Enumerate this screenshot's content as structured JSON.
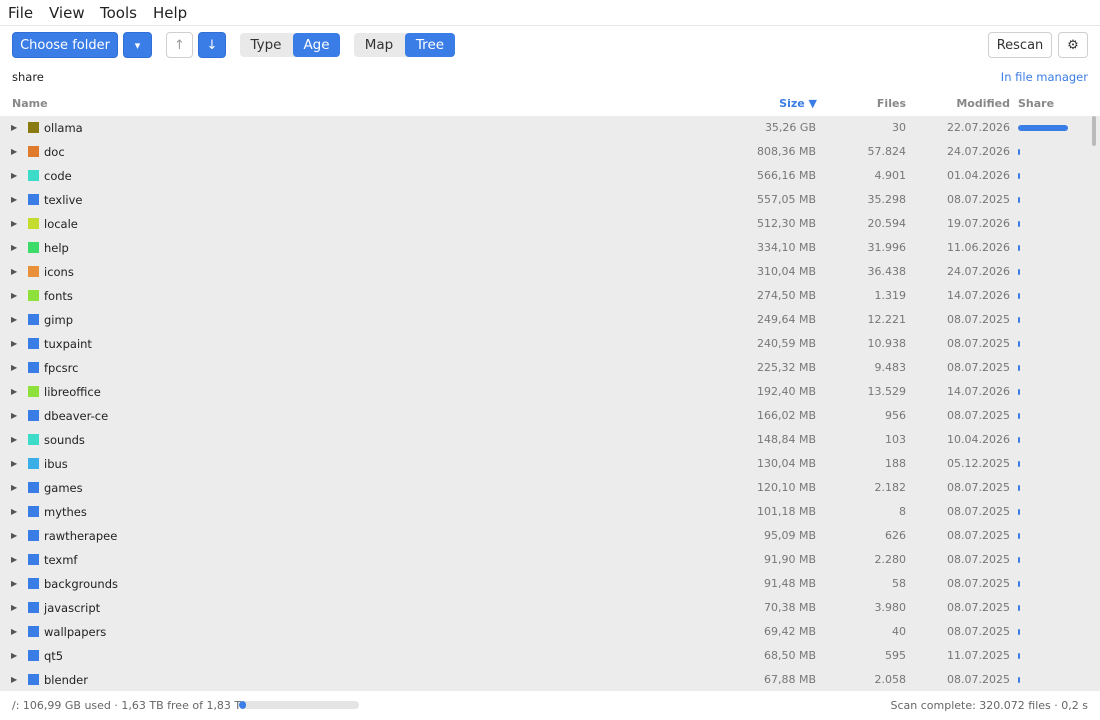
{
  "menu": [
    "File",
    "View",
    "Tools",
    "Help"
  ],
  "toolbar": {
    "choose_folder": "Choose folder",
    "dropdown_glyph": "▾",
    "sort_asc_glyph": "↑",
    "sort_desc_glyph": "↓",
    "color_mode": {
      "type": "Type",
      "age": "Age",
      "active": "Age"
    },
    "view_mode": {
      "map": "Map",
      "tree": "Tree",
      "active": "Tree"
    },
    "rescan": "Rescan",
    "settings_glyph": "⚙"
  },
  "path": "share",
  "file_manager_link": "In file manager",
  "columns": {
    "name": "Name",
    "size": "Size ▼",
    "files": "Files",
    "modified": "Modified",
    "share": "Share"
  },
  "colors": {
    "accent": "#3a7de6"
  },
  "rows": [
    {
      "name": "ollama",
      "size": "35,26 GB",
      "files": "30",
      "modified": "22.07.2026",
      "color": "#8a7a12",
      "share": 0.33
    },
    {
      "name": "doc",
      "size": "808,36 MB",
      "files": "57.824",
      "modified": "24.07.2026",
      "color": "#e07b2e",
      "share": 0.0075
    },
    {
      "name": "code",
      "size": "566,16 MB",
      "files": "4.901",
      "modified": "01.04.2026",
      "color": "#3ddcc8",
      "share": 0.0053
    },
    {
      "name": "texlive",
      "size": "557,05 MB",
      "files": "35.298",
      "modified": "08.07.2025",
      "color": "#3a7de6",
      "share": 0.0052
    },
    {
      "name": "locale",
      "size": "512,30 MB",
      "files": "20.594",
      "modified": "19.07.2026",
      "color": "#c4dc2e",
      "share": 0.0048
    },
    {
      "name": "help",
      "size": "334,10 MB",
      "files": "31.996",
      "modified": "11.06.2026",
      "color": "#3ddc6a",
      "share": 0.0031
    },
    {
      "name": "icons",
      "size": "310,04 MB",
      "files": "36.438",
      "modified": "24.07.2026",
      "color": "#e8913a",
      "share": 0.0029
    },
    {
      "name": "fonts",
      "size": "274,50 MB",
      "files": "1.319",
      "modified": "14.07.2026",
      "color": "#8ee03a",
      "share": 0.0026
    },
    {
      "name": "gimp",
      "size": "249,64 MB",
      "files": "12.221",
      "modified": "08.07.2025",
      "color": "#3a7de6",
      "share": 0.0023
    },
    {
      "name": "tuxpaint",
      "size": "240,59 MB",
      "files": "10.938",
      "modified": "08.07.2025",
      "color": "#3a7de6",
      "share": 0.0022
    },
    {
      "name": "fpcsrc",
      "size": "225,32 MB",
      "files": "9.483",
      "modified": "08.07.2025",
      "color": "#3a7de6",
      "share": 0.0021
    },
    {
      "name": "libreoffice",
      "size": "192,40 MB",
      "files": "13.529",
      "modified": "14.07.2026",
      "color": "#8ee03a",
      "share": 0.0018
    },
    {
      "name": "dbeaver-ce",
      "size": "166,02 MB",
      "files": "956",
      "modified": "08.07.2025",
      "color": "#3a7de6",
      "share": 0.0016
    },
    {
      "name": "sounds",
      "size": "148,84 MB",
      "files": "103",
      "modified": "10.04.2026",
      "color": "#3ddcc8",
      "share": 0.0014
    },
    {
      "name": "ibus",
      "size": "130,04 MB",
      "files": "188",
      "modified": "05.12.2025",
      "color": "#3aaee6",
      "share": 0.0012
    },
    {
      "name": "games",
      "size": "120,10 MB",
      "files": "2.182",
      "modified": "08.07.2025",
      "color": "#3a7de6",
      "share": 0.0011
    },
    {
      "name": "mythes",
      "size": "101,18 MB",
      "files": "8",
      "modified": "08.07.2025",
      "color": "#3a7de6",
      "share": 0.0009
    },
    {
      "name": "rawtherapee",
      "size": "95,09 MB",
      "files": "626",
      "modified": "08.07.2025",
      "color": "#3a7de6",
      "share": 0.0009
    },
    {
      "name": "texmf",
      "size": "91,90 MB",
      "files": "2.280",
      "modified": "08.07.2025",
      "color": "#3a7de6",
      "share": 0.0009
    },
    {
      "name": "backgrounds",
      "size": "91,48 MB",
      "files": "58",
      "modified": "08.07.2025",
      "color": "#3a7de6",
      "share": 0.0009
    },
    {
      "name": "javascript",
      "size": "70,38 MB",
      "files": "3.980",
      "modified": "08.07.2025",
      "color": "#3a7de6",
      "share": 0.0007
    },
    {
      "name": "wallpapers",
      "size": "69,42 MB",
      "files": "40",
      "modified": "08.07.2025",
      "color": "#3a7de6",
      "share": 0.0006
    },
    {
      "name": "qt5",
      "size": "68,50 MB",
      "files": "595",
      "modified": "11.07.2025",
      "color": "#3a7de6",
      "share": 0.0006
    },
    {
      "name": "blender",
      "size": "67,88 MB",
      "files": "2.058",
      "modified": "08.07.2025",
      "color": "#3a7de6",
      "share": 0.0006
    }
  ],
  "status": {
    "disk_text": "/: 106,99 GB used · 1,63 TB free of 1,83 TB",
    "disk_used_fraction": 0.057,
    "scan_text": "Scan complete: 320.072 files  ·  0,2 s"
  }
}
